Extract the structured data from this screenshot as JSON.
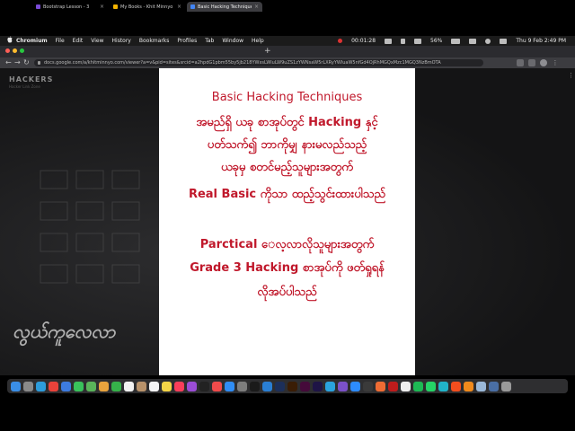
{
  "menubar": {
    "app_name": "Chromium",
    "items": [
      "File",
      "Edit",
      "View",
      "History",
      "Bookmarks",
      "Profiles",
      "Tab",
      "Window",
      "Help"
    ],
    "timer": "00:01:28",
    "battery": "56%",
    "datetime": "Thu 9 Feb  2:49 PM"
  },
  "tabs": [
    {
      "label": "Bootstrap Lesson - 3",
      "fav_color": "#7a4bd6"
    },
    {
      "label": "My Books - Khit Minnyo",
      "fav_color": "#f4b400"
    },
    {
      "label": "Basic Hacking Techniques - Fr",
      "fav_color": "#4285f4"
    }
  ],
  "toolbar": {
    "url": "docs.google.com/a/khitminnyo.com/viewer?a=v&pid=sites&srcid=a2hpdG1pbm55by5jb218YWxsLWluLW9uZS1zYWNsaW5rLXRyYWluaW5nfGd4OjRhMGQxMzc1MGQ3NzBmOTA"
  },
  "background": {
    "logo": "HACKERS",
    "logo_sub": "Hacker Link Zone",
    "bottom_logo": "လွယ်ကူလေလာ"
  },
  "document": {
    "title": "Basic Hacking Techniques",
    "lines": [
      "အမည်ရှိ ယခု စာအုပ်တွင် Hacking နှင့်",
      "ပတ်သက်၍ ဘာကိုမျှ နားမလည်သည့်",
      "ယခုမှ စတင်မည့်သူများအတွက်",
      "Real Basic ကိုသာ ထည့်သွင်းထားပါသည်",
      "",
      "Parctical ‌ေလ့လာလိုသူများအတွက်",
      "Grade 3 Hacking စာအုပ်ကို ဖတ်ရှုရန်",
      "လိုအပ်ပါသည်"
    ]
  },
  "dock": {
    "icons": [
      {
        "name": "finder-icon",
        "color": "#3a8ee6"
      },
      {
        "name": "launchpad-icon",
        "color": "#8a8a8a"
      },
      {
        "name": "safari-icon",
        "color": "#2d9cdb"
      },
      {
        "name": "chrome-icon",
        "color": "#e9423a"
      },
      {
        "name": "mail-icon",
        "color": "#3d7be0"
      },
      {
        "name": "messages-icon",
        "color": "#39c25b"
      },
      {
        "name": "maps-icon",
        "color": "#5ab45a"
      },
      {
        "name": "photos-icon",
        "color": "#e8a33d"
      },
      {
        "name": "facetime-icon",
        "color": "#36b24a"
      },
      {
        "name": "calendar-icon",
        "color": "#f2f2f2"
      },
      {
        "name": "contacts-icon",
        "color": "#b8926a"
      },
      {
        "name": "reminders-icon",
        "color": "#f5f5f5"
      },
      {
        "name": "notes-icon",
        "color": "#f5d547"
      },
      {
        "name": "music-icon",
        "color": "#fa3e5a"
      },
      {
        "name": "podcasts-icon",
        "color": "#9b4dd6"
      },
      {
        "name": "tv-icon",
        "color": "#222222"
      },
      {
        "name": "news-icon",
        "color": "#f04b4b"
      },
      {
        "name": "appstore-icon",
        "color": "#2f8df5"
      },
      {
        "name": "settings-icon",
        "color": "#7d7d7d"
      },
      {
        "name": "terminal-icon",
        "color": "#1a1a1a"
      },
      {
        "name": "vscode-icon",
        "color": "#2a7fd4"
      },
      {
        "name": "photoshop-icon",
        "color": "#1c2f5a"
      },
      {
        "name": "illustrator-icon",
        "color": "#3a1d05"
      },
      {
        "name": "xd-icon",
        "color": "#450a3a"
      },
      {
        "name": "premiere-icon",
        "color": "#1e1446"
      },
      {
        "name": "telegram-icon",
        "color": "#2aa3de"
      },
      {
        "name": "viber-icon",
        "color": "#7b51c8"
      },
      {
        "name": "zoom-icon",
        "color": "#2d8cff"
      },
      {
        "name": "obs-icon",
        "color": "#3a3a3a"
      },
      {
        "name": "postman-icon",
        "color": "#ef6c34"
      },
      {
        "name": "filezilla-icon",
        "color": "#bf1c1c"
      },
      {
        "name": "notion-icon",
        "color": "#efefef"
      },
      {
        "name": "spotify-icon",
        "color": "#1db954"
      },
      {
        "name": "whatsapp-icon",
        "color": "#25d366"
      },
      {
        "name": "canva-icon",
        "color": "#21b4c9"
      },
      {
        "name": "figma-icon",
        "color": "#f24e1e"
      },
      {
        "name": "vlc-icon",
        "color": "#f08a1c"
      },
      {
        "name": "preview-icon",
        "color": "#9ab8d8"
      },
      {
        "name": "downloads-icon",
        "color": "#4a6fa5"
      },
      {
        "name": "trash-icon",
        "color": "#9a9a9a"
      }
    ]
  },
  "colors": {
    "doc_text": "#c0182b",
    "viewer_bg": "#1d1d1f"
  }
}
